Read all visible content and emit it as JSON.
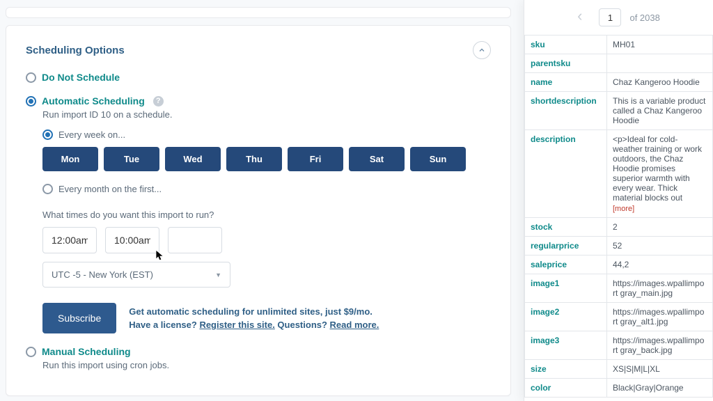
{
  "panel": {
    "title": "Scheduling Options",
    "doNotSchedule": "Do Not Schedule",
    "auto": {
      "label": "Automatic Scheduling",
      "desc": "Run import ID 10 on a schedule.",
      "weekly": "Every week on...",
      "monthly": "Every month on the first...",
      "days": [
        "Mon",
        "Tue",
        "Wed",
        "Thu",
        "Fri",
        "Sat",
        "Sun"
      ],
      "timesLabel": "What times do you want this import to run?",
      "time1": "12:00am",
      "time2": "10:00am",
      "time3": "",
      "timezone": "UTC -5 - New York (EST)"
    },
    "subscribe": {
      "button": "Subscribe",
      "line1": "Get automatic scheduling for unlimited sites, just $9/mo.",
      "line2a": "Have a license? ",
      "link1": "Register this site.",
      "line2b": " Questions? ",
      "link2": "Read more."
    },
    "manual": {
      "label": "Manual Scheduling",
      "desc": "Run this import using cron jobs."
    }
  },
  "sidebar": {
    "page": "1",
    "ofText": "of 2038",
    "rows": [
      {
        "k": "sku",
        "v": "MH01"
      },
      {
        "k": "parentsku",
        "v": ""
      },
      {
        "k": "name",
        "v": "Chaz Kangeroo Hoodie"
      },
      {
        "k": "shortdescription",
        "v": "This is a variable product called a Chaz Kangeroo Hoodie"
      },
      {
        "k": "description",
        "v": "<p>Ideal for cold-weather training or work outdoors, the Chaz Hoodie promises superior warmth with every wear. Thick material blocks out",
        "more": true
      },
      {
        "k": "stock",
        "v": "2"
      },
      {
        "k": "regularprice",
        "v": "52"
      },
      {
        "k": "saleprice",
        "v": "44,2"
      },
      {
        "k": "image1",
        "v": "https://images.wpallimport gray_main.jpg"
      },
      {
        "k": "image2",
        "v": "https://images.wpallimport gray_alt1.jpg"
      },
      {
        "k": "image3",
        "v": "https://images.wpallimport gray_back.jpg"
      },
      {
        "k": "size",
        "v": "XS|S|M|L|XL"
      },
      {
        "k": "color",
        "v": "Black|Gray|Orange"
      }
    ],
    "more": "[more]"
  }
}
